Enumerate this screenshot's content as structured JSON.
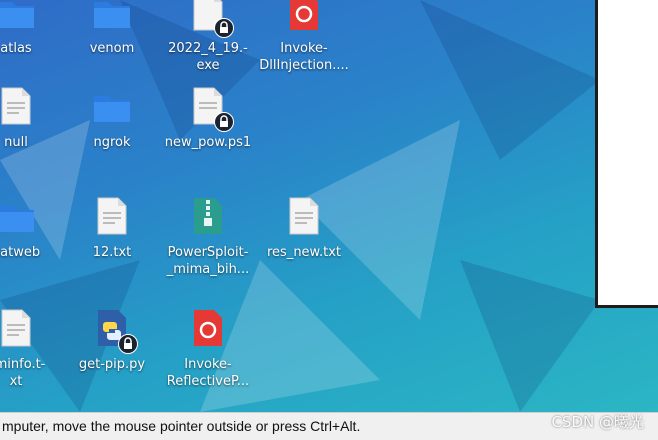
{
  "desktop": {
    "icons": [
      {
        "label": "atlas",
        "icon": "folder-icon"
      },
      {
        "label": "venom",
        "icon": "folder-icon"
      },
      {
        "label": "2022_4_19.-\nexe",
        "icon": "file-icon"
      },
      {
        "label": "Invoke-\nDllInjection....",
        "icon": "script-icon"
      },
      {
        "label": "null",
        "icon": "file-icon"
      },
      {
        "label": "ngrok",
        "icon": "folder-icon"
      },
      {
        "label": "new_pow.ps1",
        "icon": "file-icon"
      },
      {
        "label": "hatweb",
        "icon": "folder-icon"
      },
      {
        "label": "12.txt",
        "icon": "file-icon"
      },
      {
        "label": "PowerSploit-\n_mima_bih...",
        "icon": "archive-icon"
      },
      {
        "label": "res_new.txt",
        "icon": "file-icon"
      },
      {
        "label": "eminfo.t-\nxt",
        "icon": "file-icon"
      },
      {
        "label": "get-pip.py",
        "icon": "python-icon"
      },
      {
        "label": "Invoke-\nReflectiveP...",
        "icon": "script-icon"
      }
    ]
  },
  "status_bar": {
    "text": "mputer, move the mouse pointer outside or press Ctrl+Alt."
  },
  "watermark": {
    "text": "CSDN @曦光"
  },
  "colors": {
    "folder": "#2b7be0",
    "script_red": "#e53935",
    "archive_teal": "#2a9d8f",
    "python_blue": "#2f5fa8"
  }
}
